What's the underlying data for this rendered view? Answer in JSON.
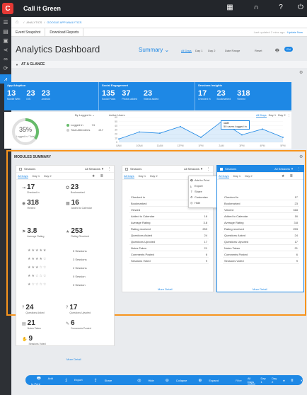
{
  "app": {
    "brand_letter": "C",
    "title": "Call it Green"
  },
  "topbar_icons": [
    "calendar-icon",
    "headset-icon",
    "help-icon",
    "power-icon"
  ],
  "sidebar": {
    "items": [
      "menu-icon",
      "reports-icon",
      "clipboard-icon",
      "share-icon",
      "link-icon",
      "sync-icon",
      "analytics-icon"
    ]
  },
  "breadcrumb": {
    "home": "⌂",
    "level1": "ANALYTICS",
    "level2": "GOOGLE APP ANALYTICS"
  },
  "subnav": {
    "tab1": "Event Snapshot",
    "tab2": "Download Reports",
    "updated": "Last updated 2 mins ago",
    "update_link": "Update Now"
  },
  "dashboard": {
    "title": "Analytics Dashboard",
    "summary": "Summary",
    "ranges": [
      "All Days",
      "Day 1",
      "Day 2",
      "Date Range"
    ],
    "reset": "Reset",
    "badge": "EN"
  },
  "at_a_glance": {
    "title": "AT A GLANCE",
    "groups": [
      {
        "title": "App Adoption",
        "stats": [
          {
            "n": "13",
            "l": "Mobile Web"
          },
          {
            "n": "23",
            "l": "iOS"
          },
          {
            "n": "23",
            "l": "Android"
          }
        ]
      },
      {
        "title": "Social Engagement",
        "stats": [
          {
            "n": "135",
            "l": "Social Posts"
          },
          {
            "n": "37",
            "l": "Photos added"
          },
          {
            "n": "23",
            "l": "Videos added"
          }
        ]
      },
      {
        "title": "Sessions Insights",
        "stats": [
          {
            "n": "17",
            "l": "Checked in"
          },
          {
            "n": "23",
            "l": "Bookmarked"
          },
          {
            "n": "318",
            "l": "Viewed"
          }
        ]
      }
    ],
    "donut": {
      "percent": "35%",
      "caption": "Logged in / Total",
      "fraction": 0.35
    },
    "by_logged": "By Logged in",
    "legend": [
      {
        "label": "Logged in",
        "value": "74",
        "color": "#66bb6a"
      },
      {
        "label": "Total Attendees",
        "value": "217",
        "color": "#cccccc"
      }
    ],
    "active_users_label": "Active Users",
    "chart_tabs": [
      "All Days",
      "Day 1",
      "Day 2"
    ],
    "tooltip": {
      "time": "1AM",
      "text": "50 users logged in"
    }
  },
  "chart_data": {
    "type": "area",
    "title": "Active Users",
    "xlabel": "",
    "ylabel": "",
    "categories": [
      "8AM",
      "10AM",
      "11AM",
      "12PM",
      "1PM",
      "2AM",
      "3PM",
      "4PM",
      "5PM"
    ],
    "series": [
      {
        "name": "",
        "values": [
          8,
          25,
          22,
          38,
          12,
          50,
          18,
          32,
          12
        ]
      }
    ],
    "y_ticks": [
      "60",
      "50",
      "40",
      "30",
      "20",
      "10",
      "0"
    ],
    "ylim": [
      0,
      60
    ],
    "color": "#1e88e5"
  },
  "modules": {
    "title": "MODULES SUMMARY",
    "card1": {
      "title": "Sessions",
      "filter": "All Sessions",
      "tabs": [
        "All Days",
        "Day 1",
        "Day 2"
      ],
      "stats": [
        {
          "n": "17",
          "l": "Checked in"
        },
        {
          "n": "23",
          "l": "Bookmarked"
        },
        {
          "n": "318",
          "l": "Viewed"
        },
        {
          "n": "16",
          "l": "Added to Calendar"
        },
        {
          "n": "3.8",
          "l": "Average Rating"
        },
        {
          "n": "253",
          "l": "Rating Received"
        },
        {
          "n": "24",
          "l": "Questions Asked"
        },
        {
          "n": "17",
          "l": "Questions Upvoted"
        },
        {
          "n": "21",
          "l": "Notes Taken"
        },
        {
          "n": "6",
          "l": "Comments Posted"
        },
        {
          "n": "9",
          "l": "Sessions Voted"
        }
      ],
      "star_rows": [
        {
          "stars": "★★★★★",
          "label": "5 Sessions"
        },
        {
          "stars": "★★★★☆",
          "label": "3 Sessions"
        },
        {
          "stars": "★★★☆☆",
          "label": "2 Sessions"
        },
        {
          "stars": "★★☆☆☆",
          "label": "0 Session"
        },
        {
          "stars": "★☆☆☆☆",
          "label": "0 Session"
        }
      ],
      "more": "More Detail"
    },
    "card2": {
      "title": "Sessions",
      "filter": "All Sessions",
      "tabs": [
        "All Days",
        "Day 1",
        "Day 2"
      ],
      "rows": [
        {
          "k": "Checked in",
          "v": ""
        },
        {
          "k": "Bookmarked",
          "v": ""
        },
        {
          "k": "Viewed",
          "v": ""
        },
        {
          "k": "Added to Calendar",
          "v": "16"
        },
        {
          "k": "Average Rating",
          "v": "3.8"
        },
        {
          "k": "Rating received",
          "v": "253"
        },
        {
          "k": "Questions Asked",
          "v": "24"
        },
        {
          "k": "Questions Upvoted",
          "v": "17"
        },
        {
          "k": "Notes Taken",
          "v": "21"
        },
        {
          "k": "Comments Posted",
          "v": "6"
        },
        {
          "k": "Sessions Voted",
          "v": "9"
        }
      ],
      "more": "More Detail",
      "menu": [
        {
          "i": "🖶",
          "t": "Add to Print"
        },
        {
          "i": "⤓",
          "t": "Export"
        },
        {
          "i": "⇪",
          "t": "Share"
        },
        {
          "i": "⚙",
          "t": "Customize"
        },
        {
          "i": "◎",
          "t": "Hide"
        }
      ]
    },
    "card3": {
      "title": "Sessions",
      "filter": "All Sessions",
      "tabs": [
        "All Days",
        "Day 1",
        "Day 2"
      ],
      "rows": [
        {
          "k": "Checked in",
          "v": "17"
        },
        {
          "k": "Bookmarked",
          "v": "23"
        },
        {
          "k": "Viewed",
          "v": "318"
        },
        {
          "k": "Added to Calendar",
          "v": "16"
        },
        {
          "k": "Average Rating",
          "v": "3.8"
        },
        {
          "k": "Rating received",
          "v": "253"
        },
        {
          "k": "Questions Asked",
          "v": "24"
        },
        {
          "k": "Questions Upvoted",
          "v": "17"
        },
        {
          "k": "Notes Taken",
          "v": "21"
        },
        {
          "k": "Comments Posted",
          "v": "6"
        },
        {
          "k": "Sessions Voted",
          "v": "9"
        }
      ],
      "more": "More Detail"
    }
  },
  "bottombar": {
    "add_to_print": "Add to Print",
    "export": "Export",
    "share": "Share",
    "hide": "Hide",
    "collapse": "Collapse",
    "expand": "Expand",
    "filter": "Filter",
    "ranges": [
      "All Days",
      "Day 1",
      "Day 2"
    ]
  }
}
